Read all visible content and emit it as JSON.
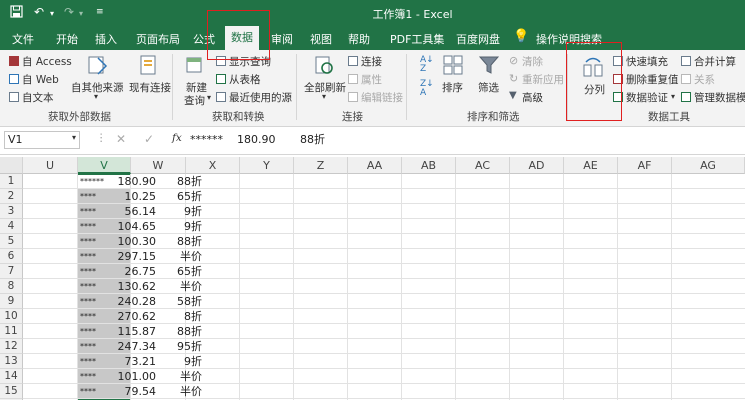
{
  "window": {
    "title": "工作簿1 - Excel",
    "quick_access": [
      "save-icon",
      "undo-icon",
      "redo-icon",
      "customize-icon"
    ]
  },
  "tabs": [
    "文件",
    "开始",
    "插入",
    "页面布局",
    "公式",
    "数据",
    "审阅",
    "视图",
    "帮助",
    "PDF工具集",
    "百度网盘",
    "操作说明搜索"
  ],
  "active_tab": "数据",
  "ribbon": {
    "get_external": {
      "access": "自 Access",
      "web": "自 Web",
      "text": "自文本",
      "other": "自其他来源",
      "existing": "现有连接",
      "label": "获取外部数据"
    },
    "get_transform": {
      "new_query": "新建",
      "new_query2": "查询",
      "show_queries": "显示查询",
      "from_table": "从表格",
      "recent": "最近使用的源",
      "label": "获取和转换"
    },
    "connections": {
      "refresh_all": "全部刷新",
      "connections": "连接",
      "properties": "属性",
      "edit_links": "编辑链接",
      "label": "连接"
    },
    "sort_filter": {
      "sort": "排序",
      "filter": "筛选",
      "clear": "清除",
      "reapply": "重新应用",
      "advanced": "高级",
      "label": "排序和筛选"
    },
    "data_tools": {
      "text_to_columns": "分列",
      "flash_fill": "快速填充",
      "remove_dup": "删除重复值",
      "validation": "数据验证",
      "consolidate": "合并计算",
      "relationships": "关系",
      "manage_model": "管理数据模型",
      "label": "数据工具"
    }
  },
  "formula_bar": {
    "name_box": "V1",
    "fx": "fx",
    "content": "******    180.90       88折"
  },
  "columns": [
    "U",
    "V",
    "W",
    "X",
    "Y",
    "Z",
    "AA",
    "AB",
    "AC",
    "AD",
    "AE",
    "AF",
    "AG"
  ],
  "rows": [
    {
      "n": "1",
      "v": "******",
      "vn": "180.90",
      "w": "88折"
    },
    {
      "n": "2",
      "v": "****",
      "vn": "10.25",
      "w": "65折"
    },
    {
      "n": "3",
      "v": "****",
      "vn": "56.14",
      "w": "9折"
    },
    {
      "n": "4",
      "v": "****",
      "vn": "104.65",
      "w": "9折"
    },
    {
      "n": "5",
      "v": "****",
      "vn": "100.30",
      "w": "88折"
    },
    {
      "n": "6",
      "v": "****",
      "vn": "297.15",
      "w": "半价"
    },
    {
      "n": "7",
      "v": "****",
      "vn": "26.75",
      "w": "65折"
    },
    {
      "n": "8",
      "v": "****",
      "vn": "130.62",
      "w": "半价"
    },
    {
      "n": "9",
      "v": "****",
      "vn": "240.28",
      "w": "58折"
    },
    {
      "n": "10",
      "v": "****",
      "vn": "270.62",
      "w": "8折"
    },
    {
      "n": "11",
      "v": "****",
      "vn": "115.87",
      "w": "88折"
    },
    {
      "n": "12",
      "v": "****",
      "vn": "247.34",
      "w": "95折"
    },
    {
      "n": "13",
      "v": "****",
      "vn": "73.21",
      "w": "9折"
    },
    {
      "n": "14",
      "v": "****",
      "vn": "101.00",
      "w": "半价"
    },
    {
      "n": "15",
      "v": "****",
      "vn": "79.54",
      "w": "半价"
    },
    {
      "n": "16",
      "v": "****",
      "vn": "270.44",
      "w": "7折"
    }
  ],
  "colors": {
    "excel_green": "#217346",
    "ribbon_bg": "#f3f3f3",
    "highlight_red": "#e02020",
    "selection": "#c6c6c6"
  }
}
